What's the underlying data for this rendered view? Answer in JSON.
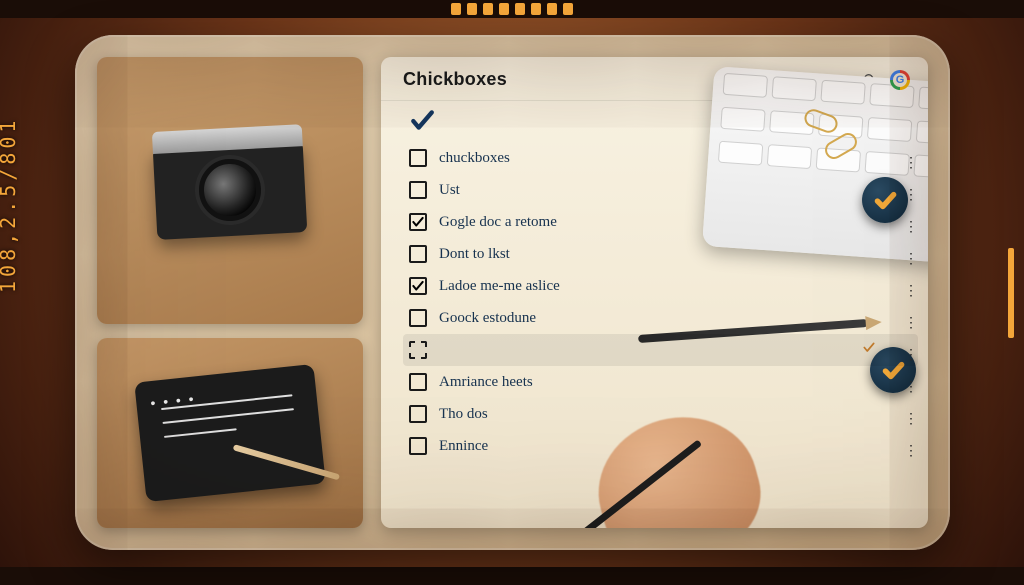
{
  "film": {
    "edge_code": "108,2.5/801"
  },
  "panel": {
    "title": "Chickboxes",
    "items": [
      {
        "label": "chuckboxes",
        "checked": false
      },
      {
        "label": "Ust",
        "checked": false
      },
      {
        "label": "Gogle doc a retome",
        "checked": true
      },
      {
        "label": "Dont to lkst",
        "checked": false
      },
      {
        "label": "Ladoe me-me aslice",
        "checked": true
      },
      {
        "label": "Goock estodune",
        "checked": false
      },
      {
        "label": "",
        "checked": false,
        "selected": true
      },
      {
        "label": "Amriance heets",
        "checked": false
      },
      {
        "label": "Tho dos",
        "checked": false
      },
      {
        "label": "Ennince",
        "checked": false
      }
    ]
  },
  "icons": {
    "search": "search-icon",
    "google": "google-icon",
    "checkmark": "checkmark-icon"
  }
}
